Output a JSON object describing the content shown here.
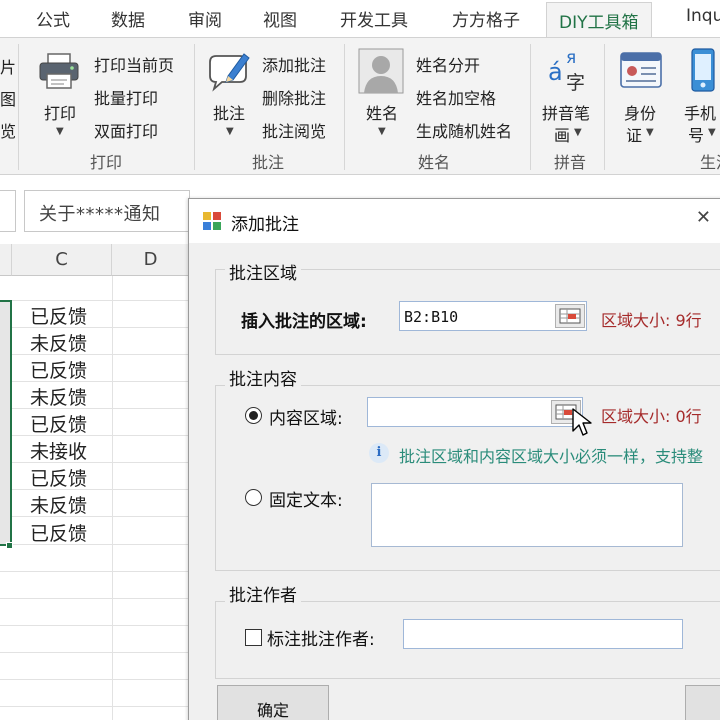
{
  "ribbon_tabs": [
    {
      "label": "公式"
    },
    {
      "label": "数据"
    },
    {
      "label": "审阅"
    },
    {
      "label": "视图"
    },
    {
      "label": "开发工具"
    },
    {
      "label": "方方格子"
    },
    {
      "label": "DIY工具箱",
      "active": true
    },
    {
      "label": "Inqu"
    }
  ],
  "ribbon": {
    "left_edge_items": [
      "片",
      "图",
      "览"
    ],
    "print_group": {
      "big_button": "打印",
      "small_buttons": [
        "打印当前页",
        "批量打印",
        "双面打印"
      ],
      "label": "打印"
    },
    "comment_group": {
      "big_button": "批注",
      "small_buttons": [
        "添加批注",
        "删除批注",
        "批注阅览"
      ],
      "label": "批注"
    },
    "name_group": {
      "big_button": "姓名",
      "small_buttons": [
        "姓名分开",
        "姓名加空格",
        "生成随机姓名"
      ],
      "label": "姓名"
    },
    "pinyin_group": {
      "big_button_line1": "拼音笔",
      "big_button_line2": "画",
      "icon_text_a": "á",
      "icon_text_ya": "я",
      "icon_text_zi": "字",
      "label": "拼音"
    },
    "id_button": {
      "line1": "身份",
      "line2": "证"
    },
    "phone_button": {
      "line1": "手机",
      "line2": "号"
    },
    "cut_group_label": "生活"
  },
  "formula_bar": {
    "text": "关于*****通知"
  },
  "sheet": {
    "columns": [
      "C",
      "D"
    ],
    "rows": [
      "已反馈",
      "未反馈",
      "已反馈",
      "未反馈",
      "已反馈",
      "未接收",
      "已反馈",
      "未反馈",
      "已反馈"
    ]
  },
  "dialog": {
    "title": "添加批注",
    "section_region": {
      "legend": "批注区域",
      "field_label": "插入批注的区域:",
      "field_value": "B2:B10",
      "size_text": "区域大小:  9行"
    },
    "section_content": {
      "legend": "批注内容",
      "radio_range_label": "内容区域:",
      "range_value": "",
      "size_text": "区域大小:  0行",
      "info_icon_text": "i",
      "hint": "批注区域和内容区域大小必须一样，支持整",
      "radio_fixed_label": "固定文本:",
      "fixed_value": ""
    },
    "section_author": {
      "legend": "批注作者",
      "checkbox_label": "标注批注作者:",
      "author_value": ""
    },
    "ok_button": "确定",
    "colors": {
      "accent": "#217346",
      "size_red": "#a52a2a",
      "hint_teal": "#2a8c7a"
    }
  }
}
